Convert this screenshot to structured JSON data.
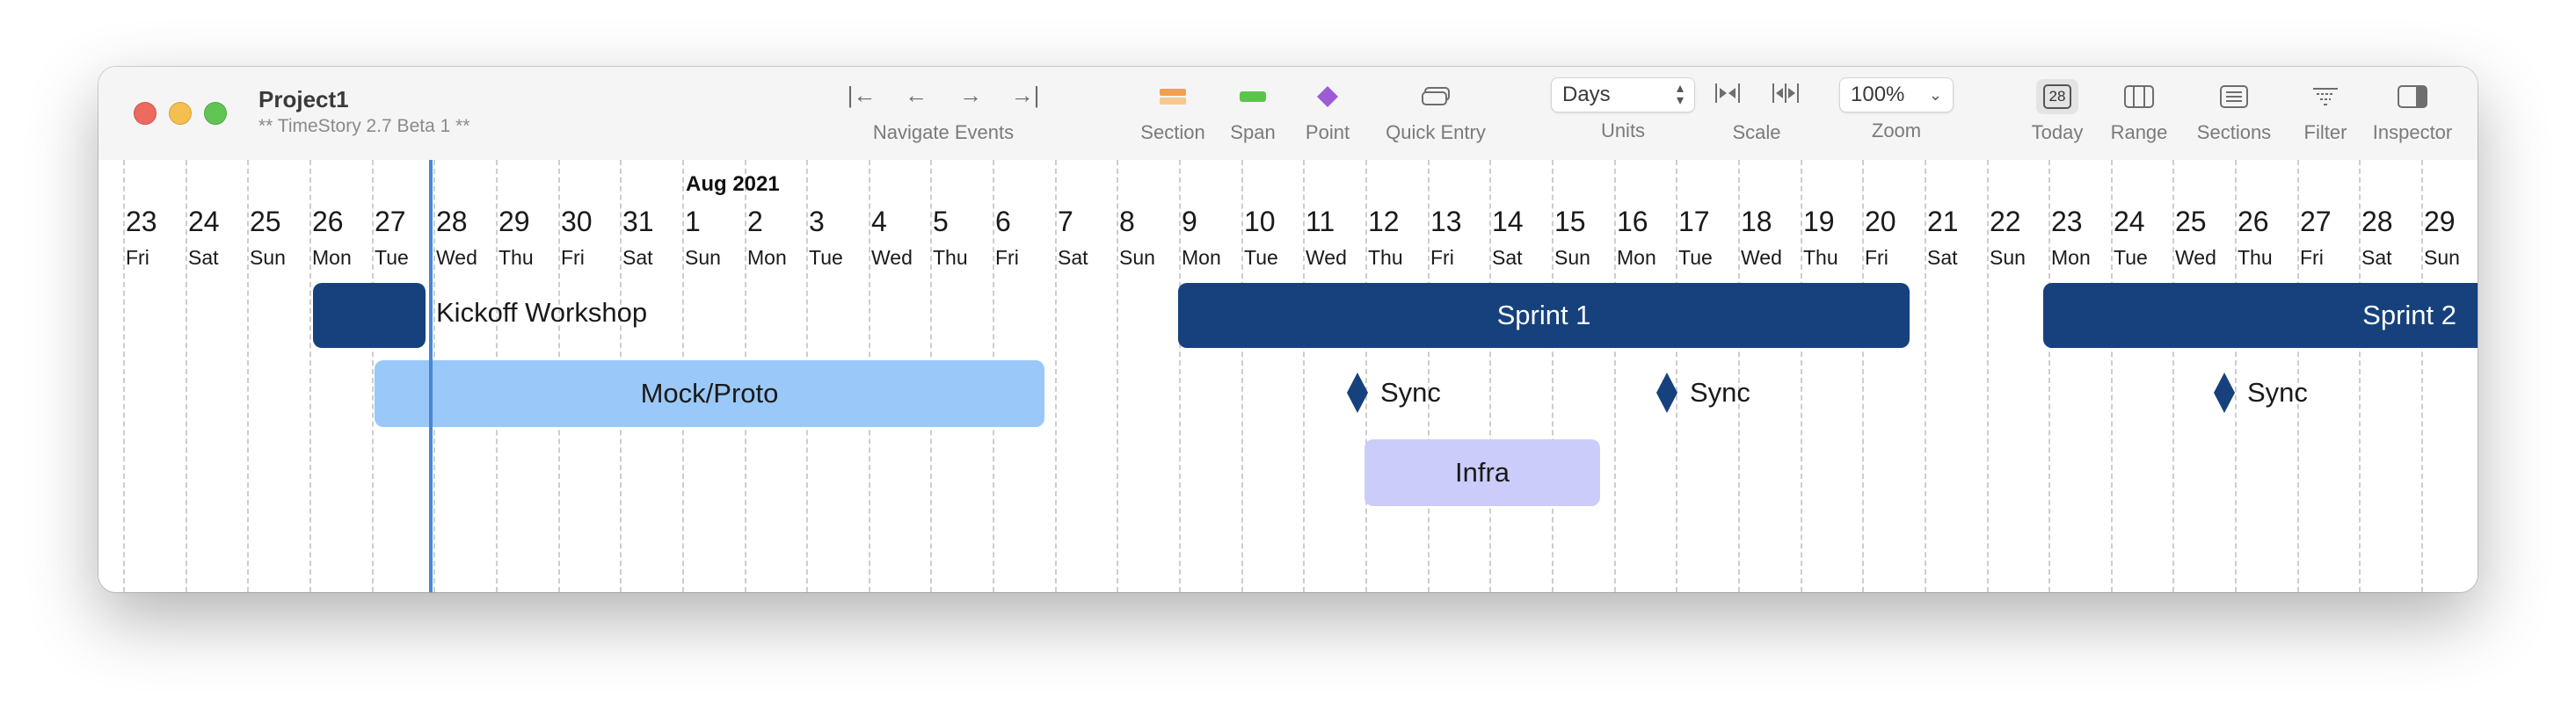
{
  "window": {
    "title": "Project1",
    "subtitle": "** TimeStory 2.7 Beta 1 **"
  },
  "toolbar": {
    "navigate": {
      "label": "Navigate Events",
      "first": "|←",
      "prev": "←",
      "next": "→",
      "last": "→|"
    },
    "section": {
      "label": "Section",
      "color": "#f0a050"
    },
    "span": {
      "label": "Span",
      "color": "#5cc44c"
    },
    "point": {
      "label": "Point",
      "color": "#9b5cd6"
    },
    "quick_entry": {
      "label": "Quick Entry"
    },
    "units": {
      "label": "Units",
      "value": "Days"
    },
    "scale": {
      "label": "Scale"
    },
    "zoom": {
      "label": "Zoom",
      "value": "100%"
    },
    "today": {
      "label": "Today",
      "day": "28"
    },
    "range": {
      "label": "Range"
    },
    "sections": {
      "label": "Sections"
    },
    "filter": {
      "label": "Filter"
    },
    "inspector": {
      "label": "Inspector"
    }
  },
  "timeline": {
    "month_label": "Aug 2021",
    "days": [
      {
        "num": "23",
        "name": "Fri"
      },
      {
        "num": "24",
        "name": "Sat"
      },
      {
        "num": "25",
        "name": "Sun"
      },
      {
        "num": "26",
        "name": "Mon"
      },
      {
        "num": "27",
        "name": "Tue"
      },
      {
        "num": "28",
        "name": "Wed"
      },
      {
        "num": "29",
        "name": "Thu"
      },
      {
        "num": "30",
        "name": "Fri"
      },
      {
        "num": "31",
        "name": "Sat"
      },
      {
        "num": "1",
        "name": "Sun"
      },
      {
        "num": "2",
        "name": "Mon"
      },
      {
        "num": "3",
        "name": "Tue"
      },
      {
        "num": "4",
        "name": "Wed"
      },
      {
        "num": "5",
        "name": "Thu"
      },
      {
        "num": "6",
        "name": "Fri"
      },
      {
        "num": "7",
        "name": "Sat"
      },
      {
        "num": "8",
        "name": "Sun"
      },
      {
        "num": "9",
        "name": "Mon"
      },
      {
        "num": "10",
        "name": "Tue"
      },
      {
        "num": "11",
        "name": "Wed"
      },
      {
        "num": "12",
        "name": "Thu"
      },
      {
        "num": "13",
        "name": "Fri"
      },
      {
        "num": "14",
        "name": "Sat"
      },
      {
        "num": "15",
        "name": "Sun"
      },
      {
        "num": "16",
        "name": "Mon"
      },
      {
        "num": "17",
        "name": "Tue"
      },
      {
        "num": "18",
        "name": "Wed"
      },
      {
        "num": "19",
        "name": "Thu"
      },
      {
        "num": "20",
        "name": "Fri"
      },
      {
        "num": "21",
        "name": "Sat"
      },
      {
        "num": "22",
        "name": "Sun"
      },
      {
        "num": "23",
        "name": "Mon"
      },
      {
        "num": "24",
        "name": "Tue"
      },
      {
        "num": "25",
        "name": "Wed"
      },
      {
        "num": "26",
        "name": "Thu"
      },
      {
        "num": "27",
        "name": "Fri"
      },
      {
        "num": "28",
        "name": "Sat"
      },
      {
        "num": "29",
        "name": "Sun"
      }
    ],
    "events": {
      "kickoff": {
        "label": "Kickoff Workshop",
        "color": "#16417c"
      },
      "mock": {
        "label": "Mock/Proto",
        "color": "#9ac8f8"
      },
      "sprint1": {
        "label": "Sprint 1",
        "color": "#16417c"
      },
      "sprint2": {
        "label": "Sprint 2",
        "color": "#16417c"
      },
      "infra": {
        "label": "Infra",
        "color": "#ccccfa"
      },
      "sync1": {
        "label": "Sync"
      },
      "sync2": {
        "label": "Sync"
      },
      "sync3": {
        "label": "Sync"
      }
    }
  }
}
